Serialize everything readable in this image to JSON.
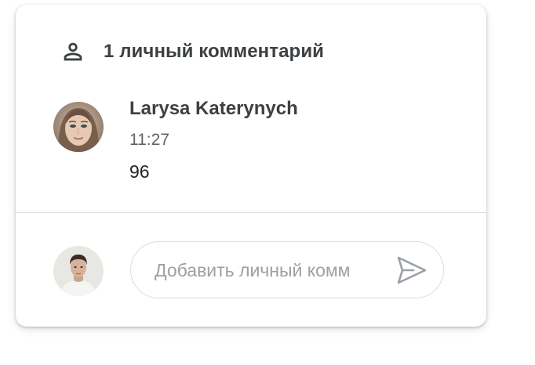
{
  "header": {
    "icon": "person-outline-icon",
    "title": "1 личный комментарий"
  },
  "comment": {
    "author": "Larysa Katerynych",
    "time": "11:27",
    "text": "96",
    "avatar_icon": "user-avatar"
  },
  "composer": {
    "placeholder": "Добавить личный комм",
    "send_icon": "send-icon",
    "avatar_icon": "current-user-avatar"
  },
  "colors": {
    "title_text": "#3c4043",
    "secondary_text": "#5f6368",
    "divider": "#dadce0",
    "placeholder": "#9aa0a6"
  }
}
